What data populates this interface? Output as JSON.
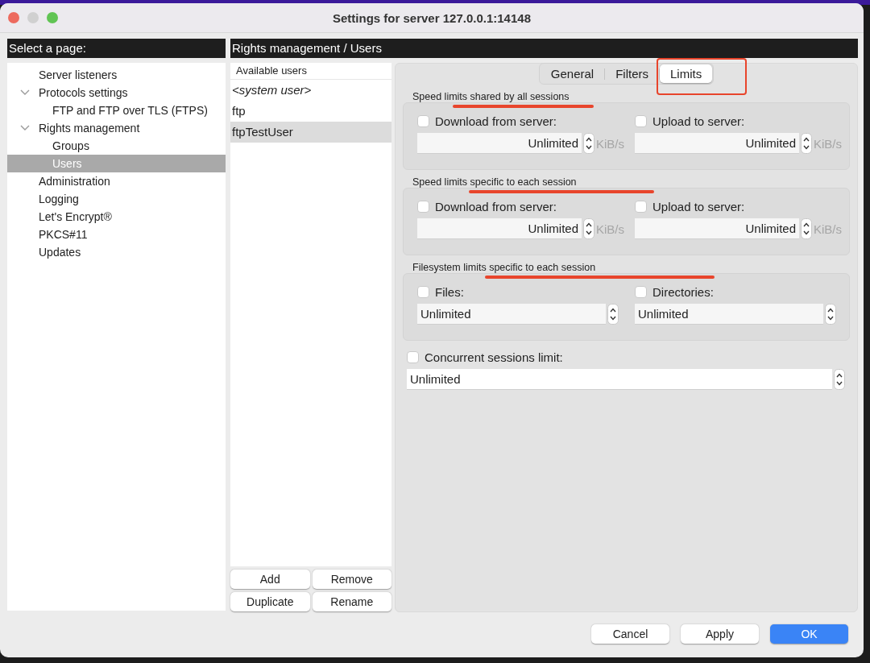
{
  "window": {
    "title": "Settings for server 127.0.0.1:14148"
  },
  "sidebar": {
    "heading": "Select a page:",
    "items": [
      {
        "label": "Server listeners",
        "selected": false
      },
      {
        "label": "Protocols settings",
        "selected": false,
        "expanded": true,
        "children": [
          {
            "label": "FTP and FTP over TLS (FTPS)",
            "selected": false
          }
        ]
      },
      {
        "label": "Rights management",
        "selected": false,
        "expanded": true,
        "children": [
          {
            "label": "Groups",
            "selected": false
          },
          {
            "label": "Users",
            "selected": true
          }
        ]
      },
      {
        "label": "Administration",
        "selected": false
      },
      {
        "label": "Logging",
        "selected": false
      },
      {
        "label": "Let's Encrypt®",
        "selected": false
      },
      {
        "label": "PKCS#11",
        "selected": false
      },
      {
        "label": "Updates",
        "selected": false
      }
    ]
  },
  "page_heading": "Rights management / Users",
  "users": {
    "heading": "Available users",
    "items": [
      {
        "label": "<system user>",
        "kind": "system",
        "selected": false
      },
      {
        "label": "ftp",
        "kind": "user",
        "selected": false
      },
      {
        "label": "ftpTestUser",
        "kind": "user",
        "selected": true
      }
    ],
    "buttons": [
      "Add",
      "Remove",
      "Duplicate",
      "Rename"
    ]
  },
  "tabs": [
    {
      "label": "General",
      "selected": false,
      "circled": false
    },
    {
      "label": "Filters",
      "selected": false,
      "circled": false
    },
    {
      "label": "Limits",
      "selected": true,
      "circled": true
    }
  ],
  "sections": [
    {
      "title": "Speed limits shared by all sessions",
      "underlined": true,
      "fields": [
        {
          "kind": "speed",
          "label": "Download from server:",
          "checked": false,
          "value": "Unlimited",
          "unit": "KiB/s"
        },
        {
          "kind": "speed",
          "label": "Upload to server:",
          "checked": false,
          "value": "Unlimited",
          "unit": "KiB/s"
        }
      ]
    },
    {
      "title": "Speed limits specific to each session",
      "underlined": true,
      "fields": [
        {
          "kind": "speed",
          "label": "Download from server:",
          "checked": false,
          "value": "Unlimited",
          "unit": "KiB/s"
        },
        {
          "kind": "speed",
          "label": "Upload to server:",
          "checked": false,
          "value": "Unlimited",
          "unit": "KiB/s"
        }
      ]
    },
    {
      "title": "Filesystem limits specific to each session",
      "underlined": true,
      "fields": [
        {
          "kind": "count",
          "label": "Files:",
          "checked": false,
          "value": "Unlimited"
        },
        {
          "kind": "count",
          "label": "Directories:",
          "checked": false,
          "value": "Unlimited"
        }
      ]
    }
  ],
  "concurrent": {
    "label": "Concurrent sessions limit:",
    "checked": false,
    "value": "Unlimited"
  },
  "dialog_buttons": [
    {
      "label": "Cancel",
      "kind": "normal"
    },
    {
      "label": "Apply",
      "kind": "normal"
    },
    {
      "label": "OK",
      "kind": "default"
    }
  ]
}
